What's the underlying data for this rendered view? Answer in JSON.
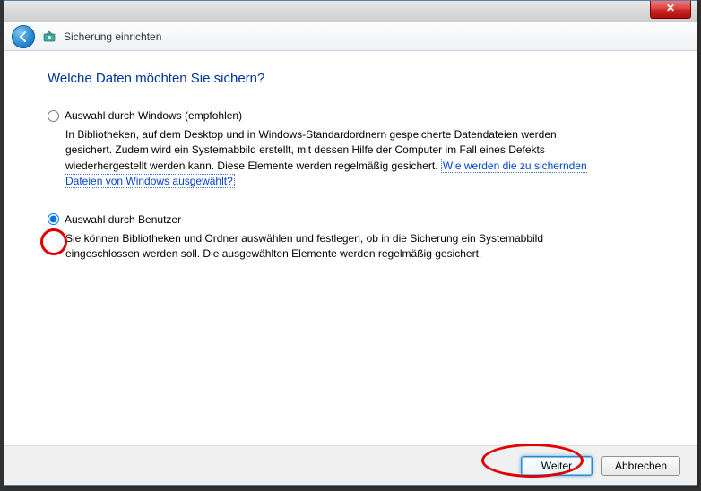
{
  "header": {
    "title": "Sicherung einrichten"
  },
  "main": {
    "heading": "Welche Daten möchten Sie sichern?",
    "options": [
      {
        "label": "Auswahl durch Windows (empfohlen)",
        "desc_pre": "In Bibliotheken, auf dem Desktop und in Windows-Standardordnern gespeicherte Datendateien werden gesichert. Zudem wird ein Systemabbild erstellt, mit dessen Hilfe der Computer im Fall eines Defekts wiederhergestellt werden kann. Diese Elemente werden regelmäßig gesichert. ",
        "link": "Wie werden die zu sichernden Dateien von Windows ausgewählt?",
        "selected": false
      },
      {
        "label": "Auswahl durch Benutzer",
        "desc_pre": "Sie können Bibliotheken und Ordner auswählen und festlegen, ob in die Sicherung ein Systemabbild eingeschlossen werden soll. Die ausgewählten Elemente werden regelmäßig gesichert.",
        "link": "",
        "selected": true
      }
    ]
  },
  "footer": {
    "next_label": "Weiter",
    "cancel_label": "Abbrechen"
  },
  "icons": {
    "close": "✕"
  }
}
